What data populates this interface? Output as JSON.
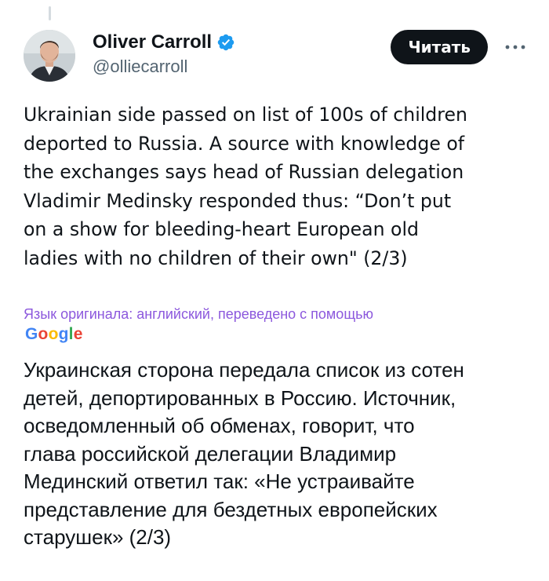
{
  "author": {
    "name": "Oliver Carroll",
    "handle": "@olliecarroll",
    "verified_icon": "verified-badge-icon",
    "verified_color": "#1d9bf0"
  },
  "actions": {
    "read_label": "Читать",
    "more_icon": "more-horizontal-icon"
  },
  "tweet": {
    "text": "Ukrainian side passed on list of 100s of children\ndeported to Russia. A source with knowledge of\nthe exchanges says head of Russian delegation\nVladimir Medinsky responded thus: “Don’t put\non a show for bleeding-heart European old\nladies with no children of their own\" (2/3)"
  },
  "translation": {
    "note": "Язык оригинала: английский, переведено с помощью",
    "note_color": "#8c58dd",
    "provider": {
      "letters": [
        "G",
        "o",
        "o",
        "g",
        "l",
        "e"
      ],
      "colors": [
        "#4285F4",
        "#EA4335",
        "#FBBC05",
        "#4285F4",
        "#34A853",
        "#EA4335"
      ]
    },
    "text": "Украинская сторона передала список из сотен\nдетей, депортированных в Россию. Источник,\nосведомленный об обменах, говорит, что\nглава российской делегации Владимир\nМединский ответил так: «Не устраивайте\nпредставление для бездетных европейских\nстарушек» (2/3)"
  }
}
